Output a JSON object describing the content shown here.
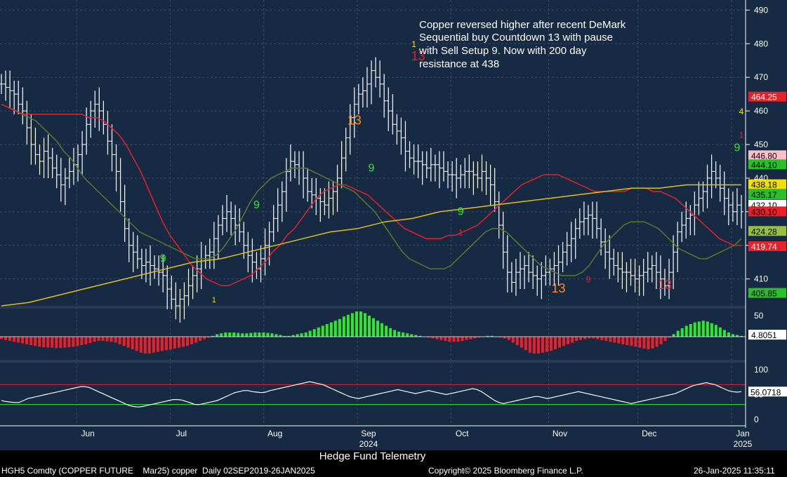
{
  "chart_data": {
    "type": "line",
    "title": "",
    "annotation": {
      "lines": [
        "Copper reversed higher after recent DeMark",
        "Sequential buy Countdown 13 with pause",
        "with Sell Setup 9.  Now with 200 day",
        "resistance at 438"
      ]
    },
    "x_months": [
      {
        "label": "Jun",
        "day": 20
      },
      {
        "label": "Jul",
        "day": 42
      },
      {
        "label": "Aug",
        "day": 64
      },
      {
        "label": "Sep",
        "day": 86
      },
      {
        "label": "Oct",
        "day": 108
      },
      {
        "label": "Nov",
        "day": 131
      },
      {
        "label": "Dec",
        "day": 152
      },
      {
        "label": "Jan",
        "day": 174
      }
    ],
    "x_years": [
      {
        "label": "2024",
        "day": 86
      },
      {
        "label": "2025",
        "day": 174
      }
    ],
    "ohlc_close": [
      468,
      467,
      466,
      465,
      462,
      460,
      455,
      450,
      447,
      445,
      448,
      446,
      443,
      441,
      438,
      440,
      442,
      444,
      447,
      450,
      456,
      460,
      462,
      460,
      456,
      451,
      447,
      442,
      433,
      425,
      420,
      418,
      416,
      414,
      415,
      414,
      413,
      412,
      411,
      407,
      404,
      402,
      404,
      405,
      408,
      411,
      413,
      416,
      417,
      418,
      422,
      426,
      428,
      430,
      428,
      426,
      424,
      420,
      417,
      415,
      413,
      416,
      420,
      424,
      428,
      432,
      436,
      442,
      445,
      444,
      443,
      440,
      436,
      435,
      434,
      433,
      432,
      434,
      436,
      440,
      446,
      452,
      458,
      462,
      465,
      466,
      468,
      472,
      470,
      468,
      463,
      460,
      456,
      454,
      452,
      448,
      446,
      445,
      445,
      444,
      443,
      444,
      444,
      443,
      442,
      441,
      441,
      440,
      441,
      442,
      442,
      441,
      440,
      442,
      440,
      438,
      433,
      426,
      418,
      412,
      409,
      412,
      413,
      414,
      412,
      411,
      410,
      411,
      412,
      413,
      414,
      415,
      418,
      420,
      422,
      425,
      427,
      428,
      429,
      428,
      425,
      421,
      418,
      416,
      414,
      413,
      412,
      412,
      411,
      410,
      411,
      412,
      413,
      414,
      412,
      410,
      408,
      412,
      418,
      424,
      426,
      428,
      429,
      432,
      434,
      436,
      440,
      442,
      440,
      437,
      434,
      432,
      430,
      432,
      430
    ],
    "sma_red": [
      462,
      461,
      460,
      459,
      459,
      459,
      459,
      459,
      459,
      459,
      459,
      459,
      458,
      458,
      457,
      455,
      453,
      450,
      446,
      442,
      437,
      432,
      427,
      423,
      420,
      417,
      414,
      412,
      410,
      409,
      408,
      408,
      409,
      410,
      411,
      413,
      415,
      418,
      420,
      423,
      425,
      428,
      431,
      434,
      436,
      437,
      438,
      438,
      437,
      436,
      435,
      433,
      431,
      429,
      427,
      425,
      424,
      423,
      422,
      422,
      422,
      423,
      423,
      424,
      425,
      426,
      428,
      430,
      432,
      434,
      436,
      438,
      439,
      440,
      441,
      441,
      441,
      440,
      439,
      438,
      437,
      436,
      436,
      436,
      436,
      436,
      437,
      437,
      437,
      436,
      436,
      435,
      434,
      432,
      430,
      428,
      426,
      424,
      422,
      421,
      420,
      420
    ],
    "sma_green": [
      462,
      461,
      460,
      459,
      458,
      457,
      455,
      453,
      451,
      448,
      446,
      443,
      440,
      438,
      436,
      434,
      432,
      430,
      428,
      426,
      424,
      423,
      422,
      421,
      420,
      419,
      418,
      417,
      416,
      416,
      416,
      417,
      419,
      422,
      425,
      429,
      433,
      436,
      438,
      440,
      441,
      442,
      443,
      443,
      443,
      442,
      441,
      440,
      439,
      438,
      437,
      436,
      434,
      432,
      430,
      427,
      424,
      421,
      418,
      416,
      415,
      414,
      413,
      413,
      413,
      414,
      416,
      418,
      420,
      422,
      424,
      425,
      425,
      424,
      422,
      420,
      418,
      416,
      414,
      413,
      412,
      411,
      411,
      411,
      412,
      414,
      417,
      420,
      422,
      424,
      426,
      427,
      427,
      427,
      426,
      425,
      423,
      421,
      419,
      418,
      417,
      416,
      416,
      417,
      418,
      419,
      420,
      422
    ],
    "sma_200": [
      402,
      403,
      405,
      407,
      409,
      411,
      413,
      415,
      416,
      418,
      420,
      422,
      424,
      425,
      427,
      428,
      430,
      431,
      432,
      433,
      434,
      435,
      436,
      437,
      437,
      438,
      438,
      438
    ],
    "price_axis": {
      "min": 402,
      "max": 493,
      "ticks": [
        410,
        420,
        430,
        440,
        450,
        460,
        470,
        480,
        490
      ]
    },
    "price_tags": [
      {
        "value": "464.25",
        "color": "#e8202a",
        "text_color": "#ffffff",
        "price": 464.25
      },
      {
        "value": "446.80",
        "color": "#ffc0cb",
        "text_color": "#000000",
        "price": 446.8
      },
      {
        "value": "444.10",
        "color": "#28c028",
        "text_color": "#000000",
        "price": 444.1
      },
      {
        "value": "438.18",
        "color": "#f0e000",
        "text_color": "#000000",
        "price": 438.18
      },
      {
        "value": "435.17",
        "color": "#28c028",
        "text_color": "#000000",
        "price": 435.17
      },
      {
        "value": "432.10",
        "color": "#ffffff",
        "text_color": "#000000",
        "price": 432.1
      },
      {
        "value": "430.10",
        "color": "#e8202a",
        "text_color": "#000000",
        "price": 430.1
      },
      {
        "value": "424.28",
        "color": "#98c040",
        "text_color": "#000000",
        "price": 424.28
      },
      {
        "value": "419.74",
        "color": "#e8202a",
        "text_color": "#ffffff",
        "price": 419.74
      },
      {
        "value": "405.85",
        "color": "#28c028",
        "text_color": "#000000",
        "price": 405.85
      }
    ],
    "demark_labels": [
      {
        "text": "13",
        "day": 83,
        "price": 456,
        "color": "#ff8c1a",
        "size": 18
      },
      {
        "text": "9",
        "day": 87,
        "price": 442,
        "color": "#2ee82e",
        "size": 16
      },
      {
        "text": "13",
        "day": 98,
        "price": 475,
        "color": "#e8202a",
        "size": 18
      },
      {
        "text": "1",
        "day": 97,
        "price": 479,
        "color": "#f0e000",
        "size": 12
      },
      {
        "text": "9",
        "day": 108,
        "price": 429,
        "color": "#2ee82e",
        "size": 16
      },
      {
        "text": "1",
        "day": 108,
        "price": 423,
        "color": "#e8202a",
        "size": 12
      },
      {
        "text": "13",
        "day": 131,
        "price": 406,
        "color": "#ff8c1a",
        "size": 18
      },
      {
        "text": "9",
        "day": 138,
        "price": 409,
        "color": "#e8202a",
        "size": 12
      },
      {
        "text": "13",
        "day": 156,
        "price": 407,
        "color": "#e8202a",
        "size": 18
      },
      {
        "text": "9",
        "day": 173,
        "price": 448,
        "color": "#2ee82e",
        "size": 16
      },
      {
        "text": "1",
        "day": 174,
        "price": 452,
        "color": "#e8202a",
        "size": 12
      },
      {
        "text": "4",
        "day": 174,
        "price": 459,
        "color": "#f0e000",
        "size": 12
      },
      {
        "text": "9",
        "day": 60,
        "price": 431,
        "color": "#2ee82e",
        "size": 16
      },
      {
        "text": "9",
        "day": 38,
        "price": 415,
        "color": "#2ee82e",
        "size": 16
      },
      {
        "text": "1",
        "day": 50,
        "price": 403,
        "color": "#f0e000",
        "size": 11
      }
    ],
    "macd": {
      "axis_ticks": [
        50,
        0
      ],
      "tag": "4.8051",
      "values": [
        -5,
        -8,
        -10,
        -12,
        -14,
        -16,
        -18,
        -20,
        -22,
        -24,
        -25,
        -26,
        -26,
        -27,
        -27,
        -26,
        -25,
        -24,
        -22,
        -20,
        -18,
        -15,
        -12,
        -10,
        -10,
        -11,
        -12,
        -14,
        -18,
        -22,
        -26,
        -30,
        -34,
        -38,
        -40,
        -40,
        -38,
        -36,
        -34,
        -32,
        -30,
        -28,
        -26,
        -24,
        -22,
        -18,
        -14,
        -10,
        -6,
        -2,
        2,
        6,
        8,
        10,
        10,
        10,
        9,
        8,
        8,
        9,
        10,
        10,
        10,
        9,
        8,
        6,
        4,
        2,
        2,
        4,
        6,
        8,
        10,
        14,
        18,
        22,
        26,
        30,
        34,
        38,
        42,
        48,
        52,
        56,
        60,
        60,
        56,
        50,
        44,
        38,
        32,
        26,
        20,
        16,
        12,
        10,
        8,
        6,
        4,
        2,
        0,
        -2,
        -4,
        -6,
        -8,
        -10,
        -12,
        -12,
        -12,
        -10,
        -8,
        -6,
        -4,
        -2,
        0,
        2,
        2,
        0,
        -2,
        -4,
        -8,
        -14,
        -20,
        -26,
        -32,
        -38,
        -40,
        -40,
        -38,
        -36,
        -34,
        -30,
        -26,
        -22,
        -18,
        -14,
        -10,
        -8,
        -6,
        -4,
        -4,
        -6,
        -8,
        -10,
        -12,
        -14,
        -16,
        -18,
        -20,
        -22,
        -24,
        -26,
        -28,
        -30,
        -28,
        -24,
        -18,
        -10,
        -2,
        6,
        14,
        20,
        26,
        30,
        34,
        36,
        38,
        36,
        32,
        28,
        22,
        16,
        10,
        6,
        4,
        2
      ],
      "zero": 0,
      "min": -50,
      "max": 60
    },
    "rsi": {
      "axis_ticks": [
        100,
        50,
        0
      ],
      "tag": "56.0718",
      "upper": 70,
      "lower": 30,
      "values": [
        38,
        36,
        35,
        34,
        34,
        38,
        42,
        44,
        46,
        48,
        50,
        52,
        54,
        56,
        58,
        60,
        62,
        64,
        66,
        66,
        64,
        60,
        56,
        52,
        48,
        44,
        40,
        36,
        32,
        28,
        26,
        25,
        26,
        28,
        30,
        32,
        34,
        36,
        38,
        40,
        40,
        39,
        36,
        33,
        30,
        30,
        32,
        34,
        36,
        38,
        42,
        46,
        50,
        54,
        56,
        58,
        58,
        56,
        55,
        54,
        55,
        58,
        60,
        62,
        64,
        66,
        68,
        70,
        72,
        74,
        76,
        74,
        72,
        70,
        66,
        62,
        58,
        54,
        50,
        46,
        44,
        42,
        44,
        46,
        48,
        50,
        52,
        54,
        56,
        58,
        60,
        58,
        56,
        54,
        52,
        54,
        56,
        58,
        56,
        54,
        52,
        50,
        52,
        54,
        56,
        58,
        60,
        62,
        60,
        56,
        50,
        44,
        38,
        34,
        32,
        34,
        36,
        38,
        40,
        42,
        44,
        46,
        46,
        44,
        42,
        44,
        46,
        48,
        50,
        52,
        54,
        56,
        54,
        52,
        50,
        48,
        46,
        44,
        42,
        40,
        38,
        36,
        34,
        32,
        34,
        36,
        38,
        40,
        42,
        44,
        46,
        48,
        50,
        52,
        56,
        60,
        64,
        68,
        70,
        72,
        74,
        72,
        70,
        66,
        62,
        58,
        56,
        55,
        56
      ],
      "min": -10,
      "max": 110
    }
  },
  "footer": {
    "ticker": "HGH5 Comdty (COPPER FUTURE    Mar25) copper  Daily 02SEP2019-26JAN2025",
    "copyright": "Copyright© 2025 Bloomberg Finance L.P.",
    "timestamp": "26-Jan-2025 11:35:11",
    "source": "Hedge Fund Telemetry"
  },
  "colors": {
    "background": "#162a44",
    "grid": "#3a4c66",
    "bars": "#ffffff",
    "sma_red": "#e8202a",
    "sma_green": "#5a7a2a",
    "sma_200": "#e0c020",
    "macd_pos": "#2ee82e",
    "macd_neg": "#e8202a",
    "rsi_line": "#ffffff"
  }
}
